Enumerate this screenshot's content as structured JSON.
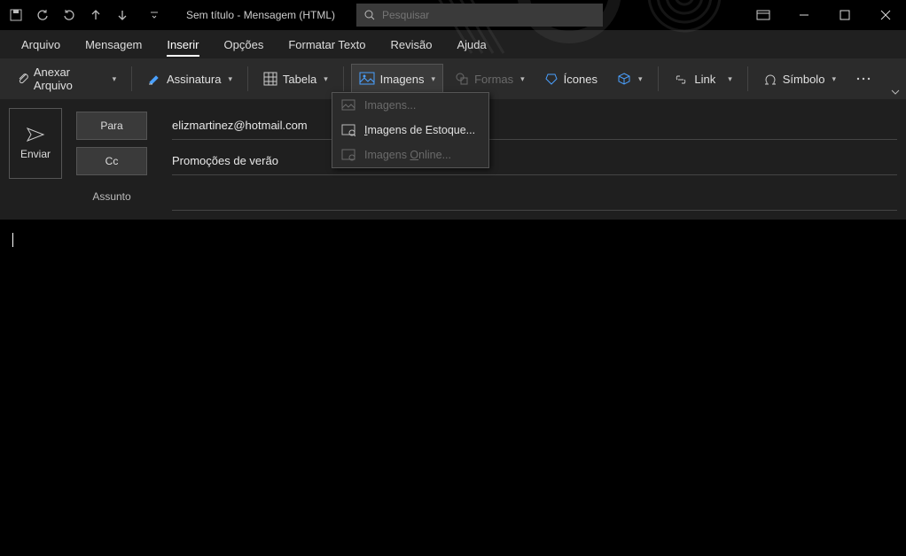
{
  "title": "Sem título  -  Mensagem (HTML)",
  "search": {
    "placeholder": "Pesquisar"
  },
  "tabs": {
    "arquivo": "Arquivo",
    "mensagem": "Mensagem",
    "inserir": "Inserir",
    "opcoes": "Opções",
    "formatar": "Formatar Texto",
    "revisao": "Revisão",
    "ajuda": "Ajuda"
  },
  "ribbon": {
    "anexar": "Anexar Arquivo",
    "assinatura": "Assinatura",
    "tabela": "Tabela",
    "imagens": "Imagens",
    "formas": "Formas",
    "icones": "Ícones",
    "link": "Link",
    "simbolo": "Símbolo"
  },
  "dropdown": {
    "imagens": "Imagens...",
    "estoque": "Imagens de Estoque...",
    "online": "Imagens Online..."
  },
  "compose": {
    "enviar": "Enviar",
    "para": "Para",
    "cc": "Cc",
    "assunto": "Assunto",
    "to_value": "elizmartinez@hotmail.com",
    "cc_value": "Promoções de verão",
    "subject_value": ""
  }
}
